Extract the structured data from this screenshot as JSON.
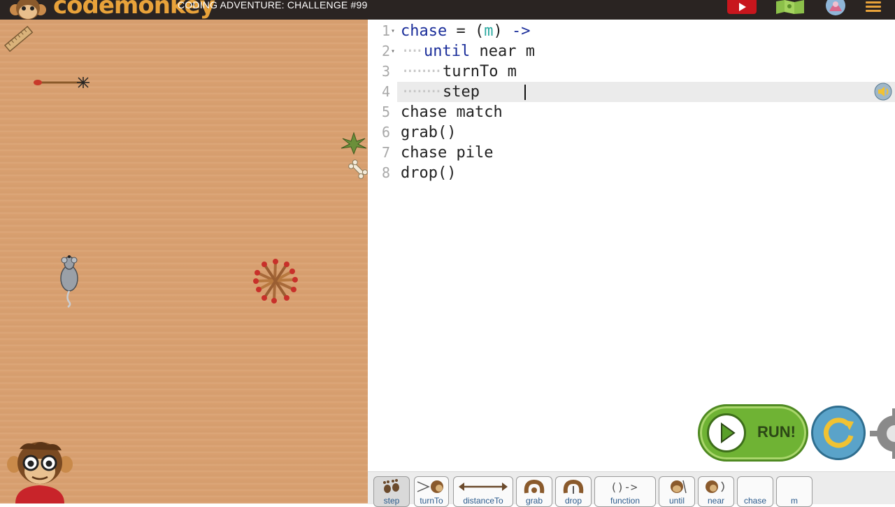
{
  "header": {
    "logo_text": "codemonkey",
    "challenge_title": "CODING ADVENTURE: CHALLENGE #99"
  },
  "editor": {
    "lines": [
      {
        "num": "1",
        "indent": "",
        "tokens": [
          {
            "t": "chase",
            "c": "kw"
          },
          {
            "t": " = (",
            "c": ""
          },
          {
            "t": "m",
            "c": "pm"
          },
          {
            "t": ") ",
            "c": ""
          },
          {
            "t": "->",
            "c": "kw"
          }
        ]
      },
      {
        "num": "2",
        "indent": "····",
        "tokens": [
          {
            "t": "until",
            "c": "kw"
          },
          {
            "t": " near m",
            "c": ""
          }
        ]
      },
      {
        "num": "3",
        "indent": "········",
        "tokens": [
          {
            "t": "turnTo m",
            "c": ""
          }
        ]
      },
      {
        "num": "4",
        "indent": "········",
        "tokens": [
          {
            "t": "step ",
            "c": ""
          }
        ]
      },
      {
        "num": "5",
        "indent": "",
        "tokens": [
          {
            "t": "chase match",
            "c": ""
          }
        ]
      },
      {
        "num": "6",
        "indent": "",
        "tokens": [
          {
            "t": "grab()",
            "c": ""
          }
        ]
      },
      {
        "num": "7",
        "indent": "",
        "tokens": [
          {
            "t": "chase pile",
            "c": ""
          }
        ]
      },
      {
        "num": "8",
        "indent": "",
        "tokens": [
          {
            "t": "drop()",
            "c": ""
          }
        ]
      }
    ]
  },
  "controls": {
    "run_label": "RUN!"
  },
  "toolbar": {
    "tools": [
      {
        "label": "step",
        "icon": "footprints-icon"
      },
      {
        "label": "turnTo",
        "icon": "turnto-icon"
      },
      {
        "label": "distanceTo",
        "icon": "distance-arrow-icon"
      },
      {
        "label": "grab",
        "icon": "grab-hand-icon"
      },
      {
        "label": "drop",
        "icon": "drop-hand-icon"
      },
      {
        "label": "function",
        "icon": "function-arrow-icon"
      },
      {
        "label": "until",
        "icon": "until-icon"
      },
      {
        "label": "near",
        "icon": "near-icon"
      },
      {
        "label": "chase",
        "icon": ""
      },
      {
        "label": "m",
        "icon": ""
      }
    ]
  },
  "colors": {
    "stage": "#d9a070",
    "keyword": "#1b2e9a",
    "param": "#2aa9a0",
    "run_green": "#6fb334",
    "reset_blue": "#5aa3c9",
    "topbar": "#2a2422"
  }
}
